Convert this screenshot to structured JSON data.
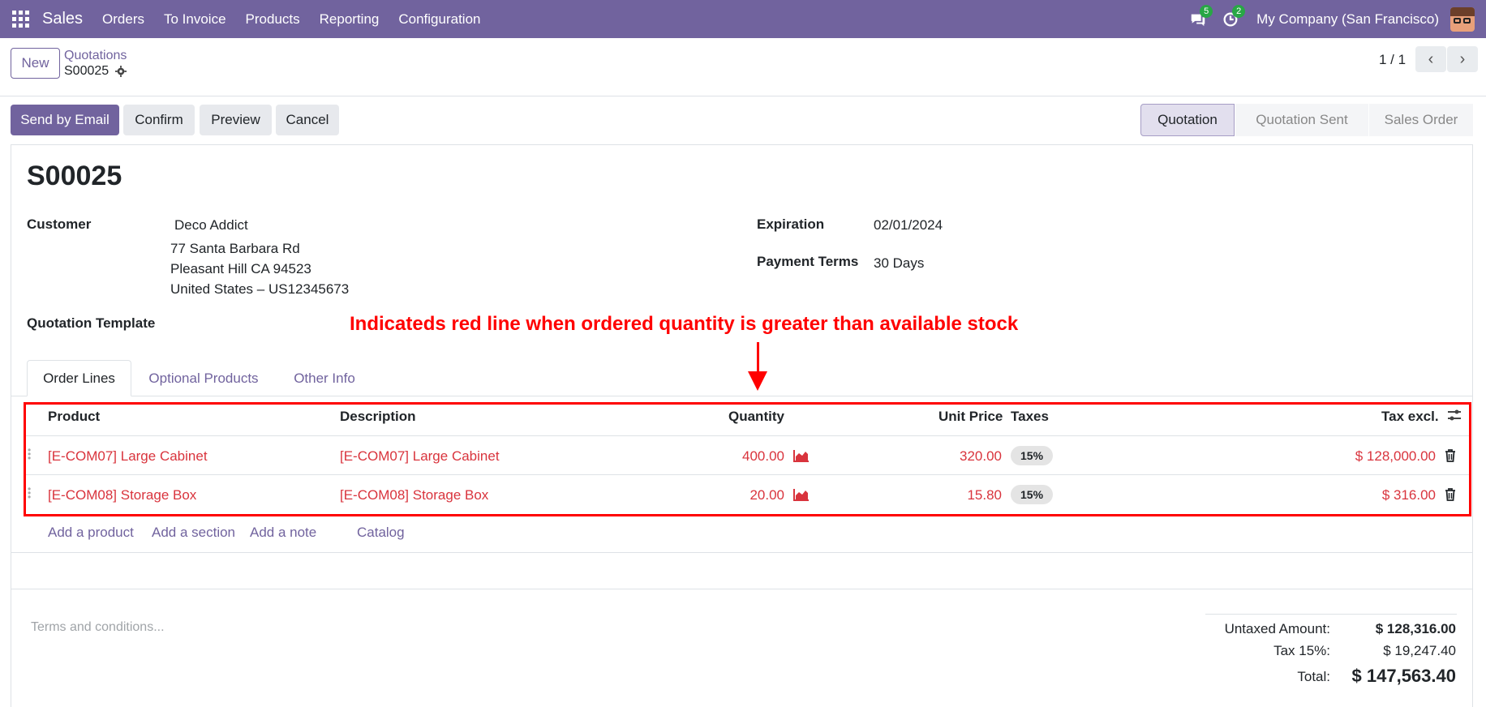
{
  "navbar": {
    "app_name": "Sales",
    "menu": [
      "Orders",
      "To Invoice",
      "Products",
      "Reporting",
      "Configuration"
    ],
    "messages_count": "5",
    "activities_count": "2",
    "company": "My Company (San Francisco)"
  },
  "control": {
    "new_label": "New",
    "breadcrumb_parent": "Quotations",
    "breadcrumb_current": "S00025",
    "pager": "1 / 1"
  },
  "actions": {
    "send_email": "Send by Email",
    "confirm": "Confirm",
    "preview": "Preview",
    "cancel": "Cancel"
  },
  "stages": [
    "Quotation",
    "Quotation Sent",
    "Sales Order"
  ],
  "form": {
    "title": "S00025",
    "customer_label": "Customer",
    "customer_name": "Deco Addict",
    "address_line1": "77 Santa Barbara Rd",
    "address_line2": "Pleasant Hill CA 94523",
    "address_line3": "United States – US12345673",
    "expiration_label": "Expiration",
    "expiration_value": "02/01/2024",
    "payment_terms_label": "Payment Terms",
    "payment_terms_value": "30 Days",
    "template_label": "Quotation Template"
  },
  "annotation": "Indicateds red line when ordered quantity is greater than available stock",
  "tabs": [
    "Order Lines",
    "Optional Products",
    "Other Info"
  ],
  "table": {
    "headers": {
      "product": "Product",
      "description": "Description",
      "quantity": "Quantity",
      "unit_price": "Unit Price",
      "taxes": "Taxes",
      "tax_excl": "Tax excl."
    },
    "rows": [
      {
        "product": "[E-COM07] Large Cabinet",
        "description": "[E-COM07] Large Cabinet",
        "quantity": "400.00",
        "unit_price": "320.00",
        "tax": "15%",
        "subtotal": "$ 128,000.00"
      },
      {
        "product": "[E-COM08] Storage Box",
        "description": "[E-COM08] Storage Box",
        "quantity": "20.00",
        "unit_price": "15.80",
        "tax": "15%",
        "subtotal": "$ 316.00"
      }
    ],
    "add_product": "Add a product",
    "add_section": "Add a section",
    "add_note": "Add a note",
    "catalog": "Catalog"
  },
  "footer": {
    "terms_placeholder": "Terms and conditions...",
    "untaxed_label": "Untaxed Amount:",
    "untaxed_value": "$ 128,316.00",
    "tax_label": "Tax 15%:",
    "tax_value": "$ 19,247.40",
    "total_label": "Total:",
    "total_value": "$ 147,563.40"
  },
  "colors": {
    "brand": "#71639e",
    "warning_red": "#d9343d",
    "annotation_red": "#ff0000"
  }
}
